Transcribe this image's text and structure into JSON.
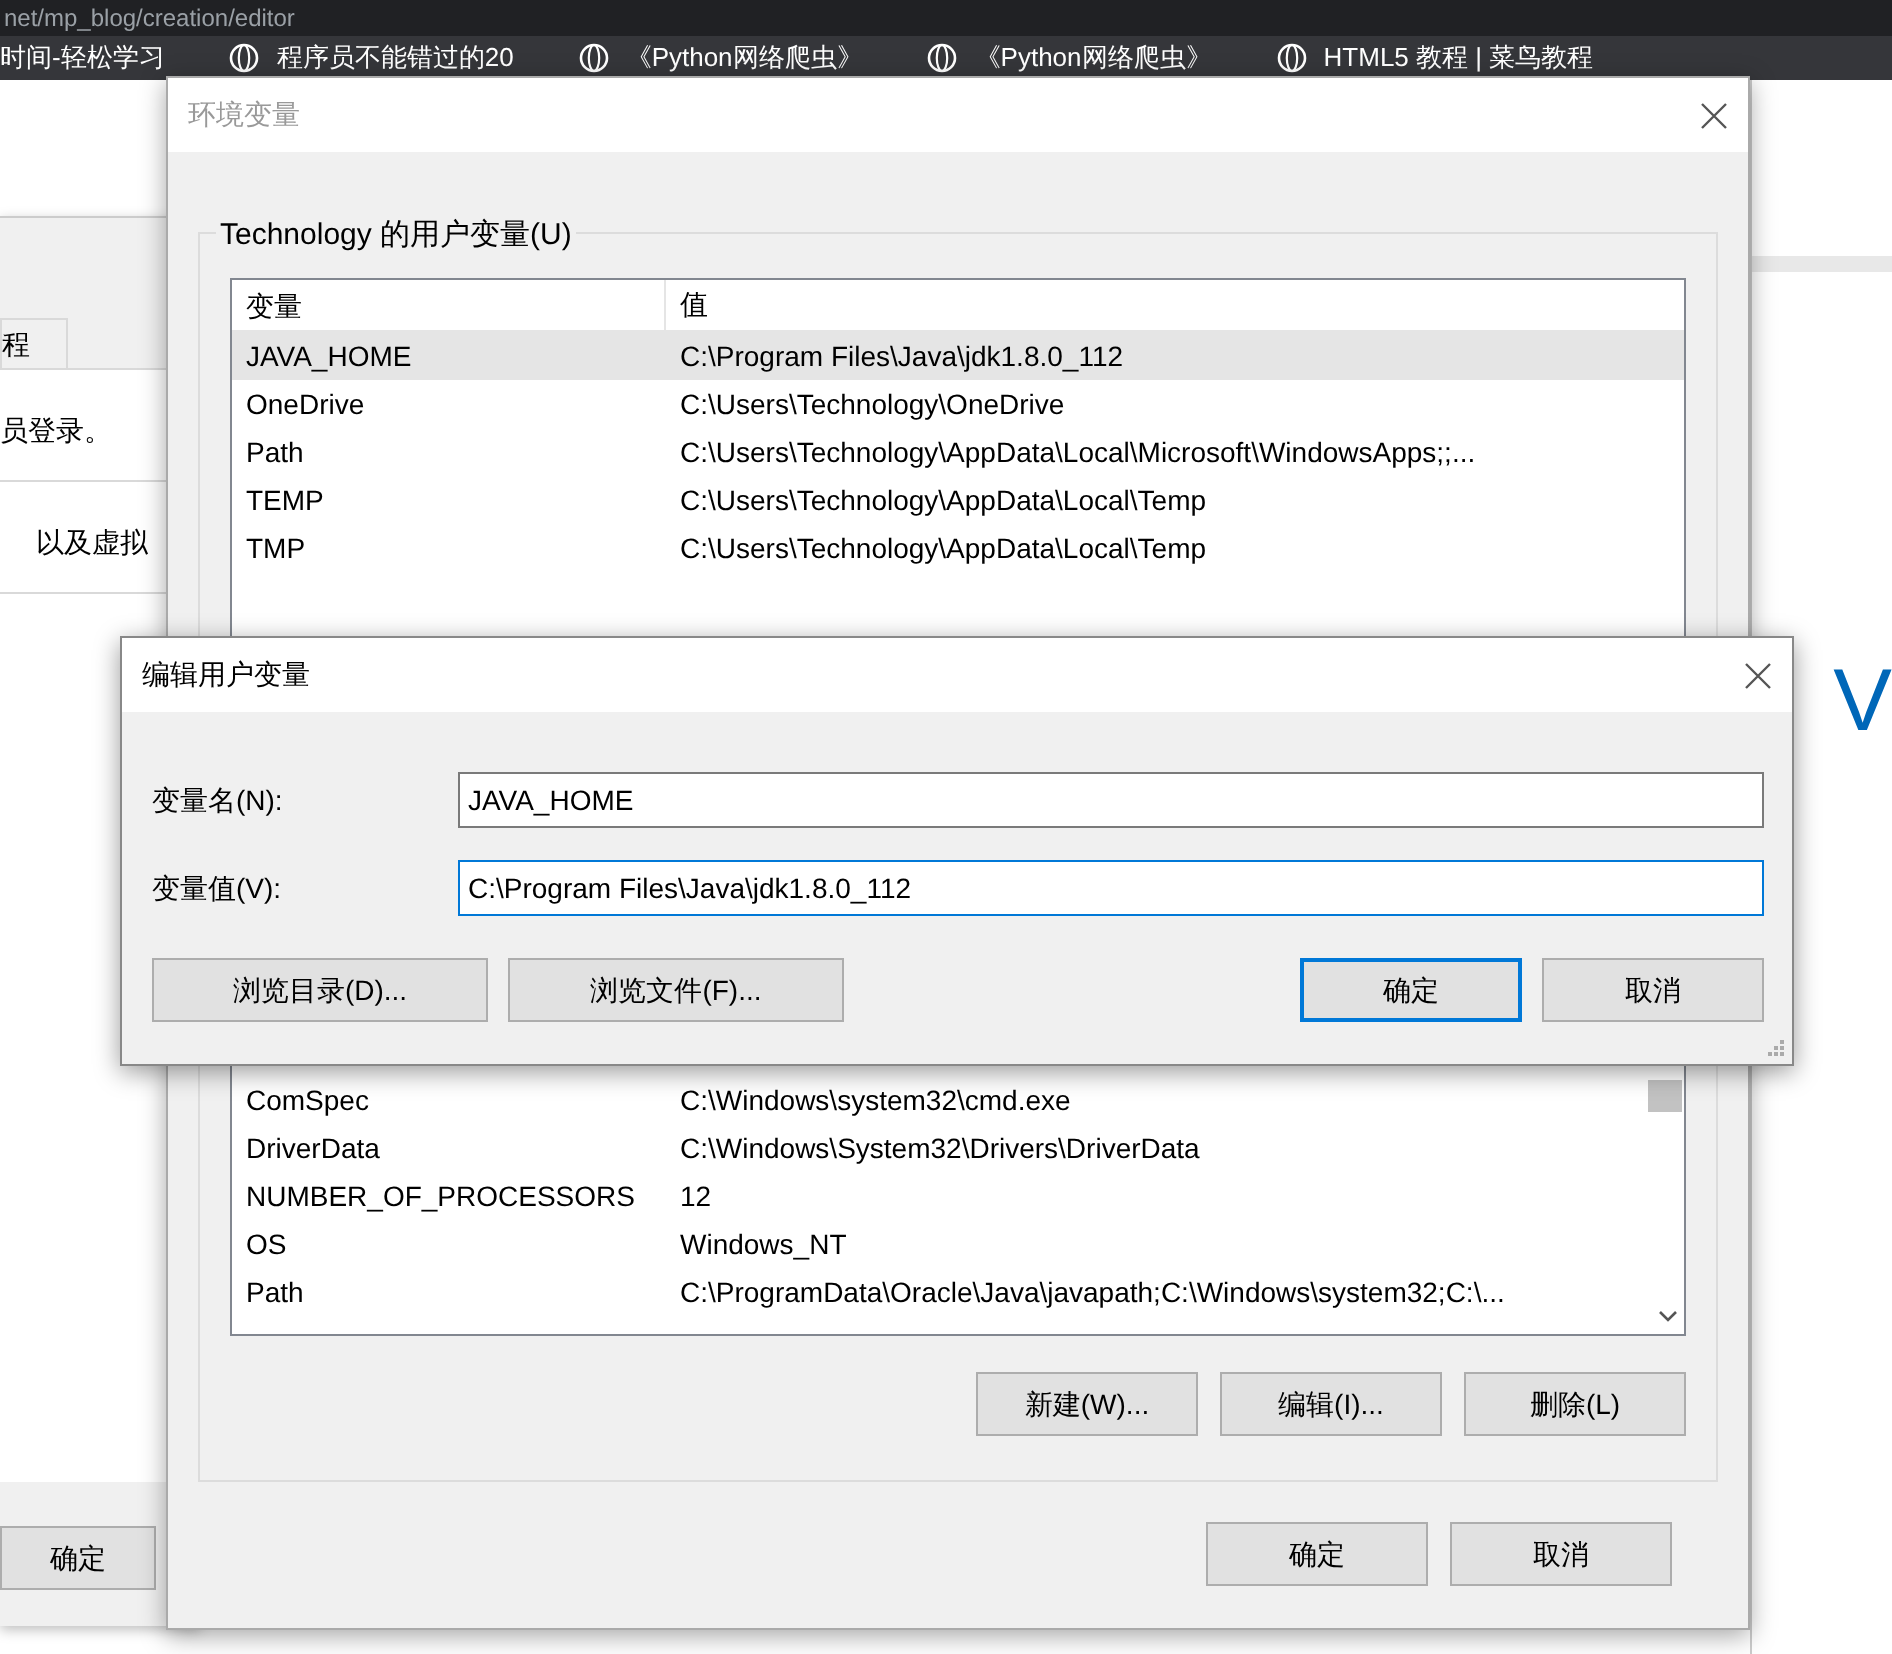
{
  "browser": {
    "url": "net/mp_blog/creation/editor",
    "bookmarks": [
      {
        "label": "时间-轻松学习"
      },
      {
        "label": "程序员不能错过的20"
      },
      {
        "label": "《Python网络爬虫》"
      },
      {
        "label": "《Python网络爬虫》"
      },
      {
        "label": "HTML5 教程 | 菜鸟教程"
      }
    ]
  },
  "back_window": {
    "tab": "程",
    "lines": [
      "员登录。",
      "以及虚拟"
    ],
    "ok_button": "确定"
  },
  "banner": {
    "letter": "V"
  },
  "env_dialog": {
    "title": "环境变量",
    "user_group": "Technology 的用户变量(U)",
    "columns": [
      "变量",
      "值"
    ],
    "user_vars": [
      {
        "name": "JAVA_HOME",
        "value": "C:\\Program Files\\Java\\jdk1.8.0_112",
        "selected": true
      },
      {
        "name": "OneDrive",
        "value": "C:\\Users\\Technology\\OneDrive",
        "selected": false
      },
      {
        "name": "Path",
        "value": "C:\\Users\\Technology\\AppData\\Local\\Microsoft\\WindowsApps;;...",
        "selected": false
      },
      {
        "name": "TEMP",
        "value": "C:\\Users\\Technology\\AppData\\Local\\Temp",
        "selected": false
      },
      {
        "name": "TMP",
        "value": "C:\\Users\\Technology\\AppData\\Local\\Temp",
        "selected": false
      }
    ],
    "system_vars": [
      {
        "name": "ComSpec",
        "value": "C:\\Windows\\system32\\cmd.exe"
      },
      {
        "name": "DriverData",
        "value": "C:\\Windows\\System32\\Drivers\\DriverData"
      },
      {
        "name": "NUMBER_OF_PROCESSORS",
        "value": "12"
      },
      {
        "name": "OS",
        "value": "Windows_NT"
      },
      {
        "name": "Path",
        "value": "C:\\ProgramData\\Oracle\\Java\\javapath;C:\\Windows\\system32;C:\\..."
      }
    ],
    "system_buttons": [
      "新建(W)...",
      "编辑(I)...",
      "删除(L)"
    ],
    "footer_buttons": [
      "确定",
      "取消"
    ]
  },
  "edit_dialog": {
    "title": "编辑用户变量",
    "fields": [
      {
        "label": "变量名(N):",
        "value": "JAVA_HOME",
        "focused": false
      },
      {
        "label": "变量值(V):",
        "value": "C:\\Program Files\\Java\\jdk1.8.0_112",
        "focused": true
      }
    ],
    "left_buttons": [
      "浏览目录(D)...",
      "浏览文件(F)..."
    ],
    "right_buttons": [
      {
        "label": "确定",
        "default": true
      },
      {
        "label": "取消",
        "default": false
      }
    ]
  }
}
